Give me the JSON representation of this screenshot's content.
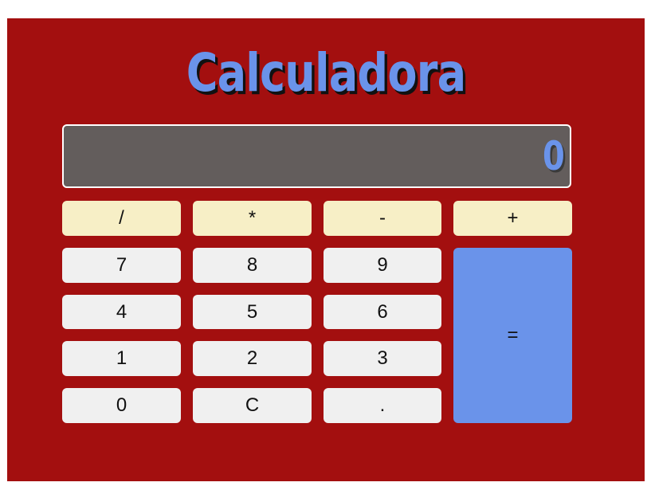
{
  "app": {
    "title": "Calculadora"
  },
  "display": {
    "value": "0"
  },
  "keys": {
    "divide": "/",
    "multiply": "*",
    "subtract": "-",
    "add": "+",
    "seven": "7",
    "eight": "8",
    "nine": "9",
    "four": "4",
    "five": "5",
    "six": "6",
    "one": "1",
    "two": "2",
    "three": "3",
    "zero": "0",
    "clear": "C",
    "decimal": ".",
    "equals": "="
  },
  "colors": {
    "background": "#a30f0f",
    "accent": "#6a93ea",
    "display_bg": "#635d5c",
    "operator_key": "#f7efc6",
    "number_key": "#f0f0f0"
  }
}
